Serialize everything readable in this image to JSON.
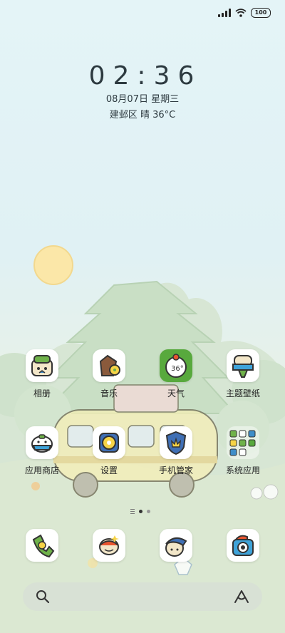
{
  "status_bar": {
    "battery": "100",
    "signal_icon": "signal-icon",
    "wifi_icon": "wifi-icon"
  },
  "lockclock": {
    "time": "02:36",
    "date": "08月07日 星期三",
    "location": "建邺区",
    "condition": "晴",
    "temperature": "36°C"
  },
  "home_row1": [
    {
      "label": "相册",
      "icon": "album-icon"
    },
    {
      "label": "音乐",
      "icon": "music-icon"
    },
    {
      "label": "天气",
      "icon": "weather-icon",
      "badge": "36°"
    },
    {
      "label": "主题壁纸",
      "icon": "theme-icon"
    }
  ],
  "home_row2": [
    {
      "label": "应用商店",
      "icon": "app-store-icon"
    },
    {
      "label": "设置",
      "icon": "settings-icon"
    },
    {
      "label": "手机管家",
      "icon": "security-icon"
    },
    {
      "label": "系统应用",
      "icon": "folder-icon"
    }
  ],
  "dock": [
    {
      "icon": "phone-icon"
    },
    {
      "icon": "messages-icon"
    },
    {
      "icon": "browser-icon"
    },
    {
      "icon": "camera-icon"
    }
  ],
  "page_indicator": {
    "pages": 2,
    "current": 1
  },
  "search_bar": {
    "search_icon": "search-icon",
    "assistant_icon": "assistant-icon"
  }
}
